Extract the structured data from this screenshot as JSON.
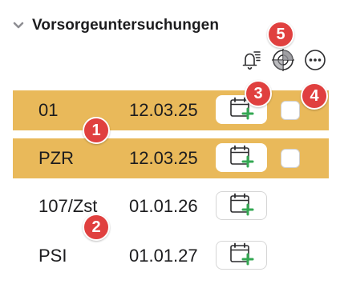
{
  "section": {
    "title": "Vorsorgeuntersuchungen",
    "chevron_icon": "chevron-down-icon"
  },
  "toolbar": {
    "icons": [
      "bell-list-icon",
      "crosshair-globe-icon",
      "more-options-icon"
    ]
  },
  "rows": [
    {
      "code": "01",
      "date": "12.03.25",
      "highlighted": true,
      "has_checkbox": true
    },
    {
      "code": "PZR",
      "date": "12.03.25",
      "highlighted": true,
      "has_checkbox": true
    },
    {
      "code": "107/Zst",
      "date": "01.01.26",
      "highlighted": false,
      "has_checkbox": false
    },
    {
      "code": "PSI",
      "date": "01.01.27",
      "highlighted": false,
      "has_checkbox": false
    }
  ],
  "badges": [
    "1",
    "2",
    "3",
    "4",
    "5"
  ],
  "colors": {
    "highlight": "#e9b95a",
    "badge": "#e0403f",
    "calendar_plus": "#34a853"
  }
}
